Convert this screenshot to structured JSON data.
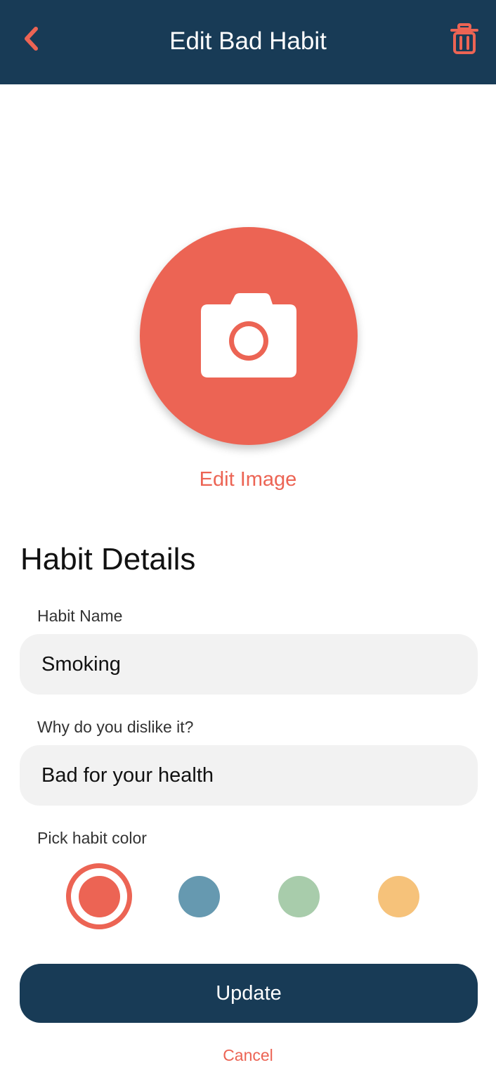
{
  "header": {
    "title": "Edit Bad Habit",
    "back_icon": "chevron-left-icon",
    "delete_icon": "trash-icon"
  },
  "image": {
    "icon": "camera-icon",
    "edit_label": "Edit Image"
  },
  "details": {
    "title": "Habit Details",
    "name_label": "Habit Name",
    "name_value": "Smoking",
    "reason_label": "Why do you dislike it?",
    "reason_value": "Bad for your health",
    "color_label": "Pick habit color",
    "colors": [
      "#ec6454",
      "#6699b0",
      "#a8ccab",
      "#f6c27a"
    ],
    "selected_color": "#ec6454"
  },
  "actions": {
    "update_label": "Update",
    "cancel_label": "Cancel"
  },
  "theme": {
    "navy": "#183b56",
    "accent": "#ec6454"
  }
}
